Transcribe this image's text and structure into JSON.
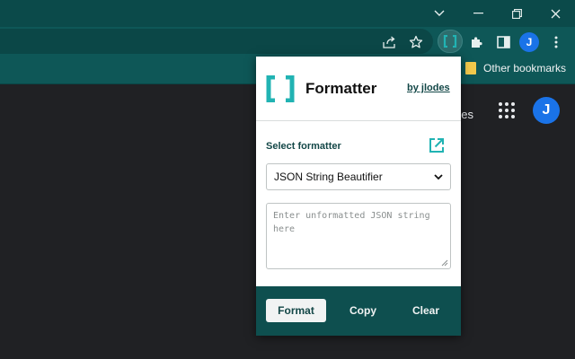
{
  "browser": {
    "avatar_initial": "J",
    "bookmarks": {
      "other_label": "Other bookmarks"
    }
  },
  "page": {
    "partial_link": "ges",
    "avatar_initial": "J"
  },
  "popup": {
    "title": "Formatter",
    "author_link": "by jlodes",
    "select_label": "Select formatter",
    "select_value": "JSON String Beautifier",
    "input_placeholder": "Enter unformatted JSON string here",
    "buttons": {
      "format": "Format",
      "copy": "Copy",
      "clear": "Clear"
    }
  },
  "colors": {
    "accent_teal": "#21b3b3",
    "frame_dark": "#0b4a4a",
    "footer": "#0e4f4f",
    "avatar_blue": "#1a73e8"
  }
}
